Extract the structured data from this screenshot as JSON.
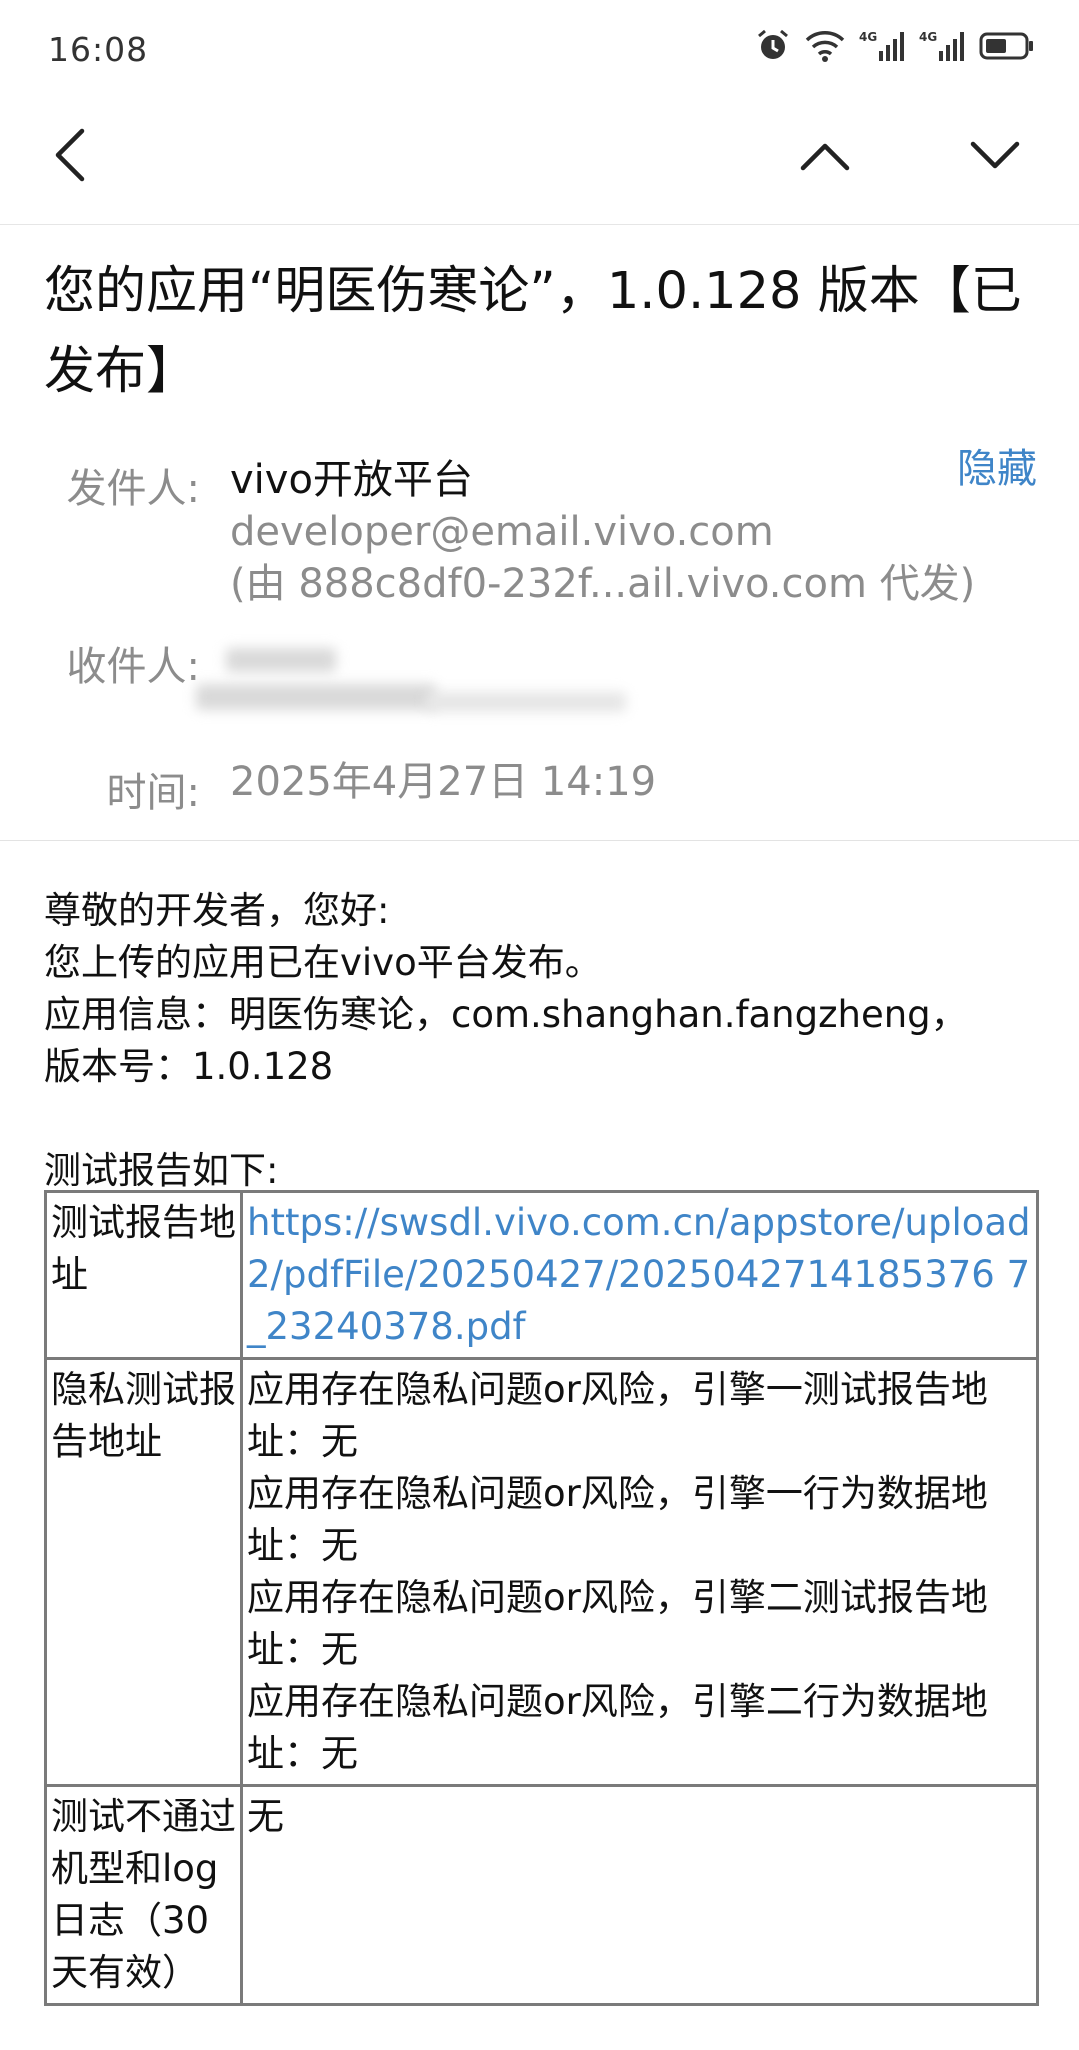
{
  "status_bar": {
    "time": "16:08",
    "icons": [
      "alarm-icon",
      "wifi-icon",
      "signal-4g-icon",
      "signal-4g-icon",
      "battery-icon"
    ],
    "network_1": "4G",
    "network_2": "4G"
  },
  "nav": {
    "icons": [
      "back-icon",
      "chevron-up-icon",
      "chevron-down-icon"
    ]
  },
  "email": {
    "subject": "您的应用“明医伤寒论”，1.0.128 版本【已发布】",
    "from_label": "发件人:",
    "from_name": "vivo开放平台",
    "from_email": "developer@email.vivo.com",
    "from_proxy": "(由 888c8df0-232f...ail.vivo.com 代发)",
    "hide_label": "隐藏",
    "to_label": "收件人:",
    "time_label": "时间:",
    "time_value": "2025年4月27日 14:19"
  },
  "body": {
    "lines": [
      "尊敬的开发者，您好:",
      "您上传的应用已在vivo平台发布。",
      "应用信息：明医伤寒论，com.shanghan.fangzheng，",
      "版本号：1.0.128"
    ],
    "report_intro": "测试报告如下:"
  },
  "table": {
    "rows": [
      {
        "label": "测试报告地址",
        "link": "https://swsdl.vivo.com.cn/appstore/upload2/pdfFile/20250427/2025042714185376 7_23240378.pdf"
      },
      {
        "label": "隐私测试报告地址",
        "lines": [
          "应用存在隐私问题or风险，引擎一测试报告地址：无",
          "应用存在隐私问题or风险，引擎一行为数据地址：无",
          "应用存在隐私问题or风险，引擎二测试报告地址：无",
          "应用存在隐私问题or风险，引擎二行为数据地址：无"
        ]
      },
      {
        "label": "测试不通过机型和log日志（30天有效）",
        "value": "无"
      }
    ]
  },
  "colors": {
    "link": "#3f85c8",
    "label_gray": "#8c8c8c",
    "border": "#7a7a7a"
  }
}
